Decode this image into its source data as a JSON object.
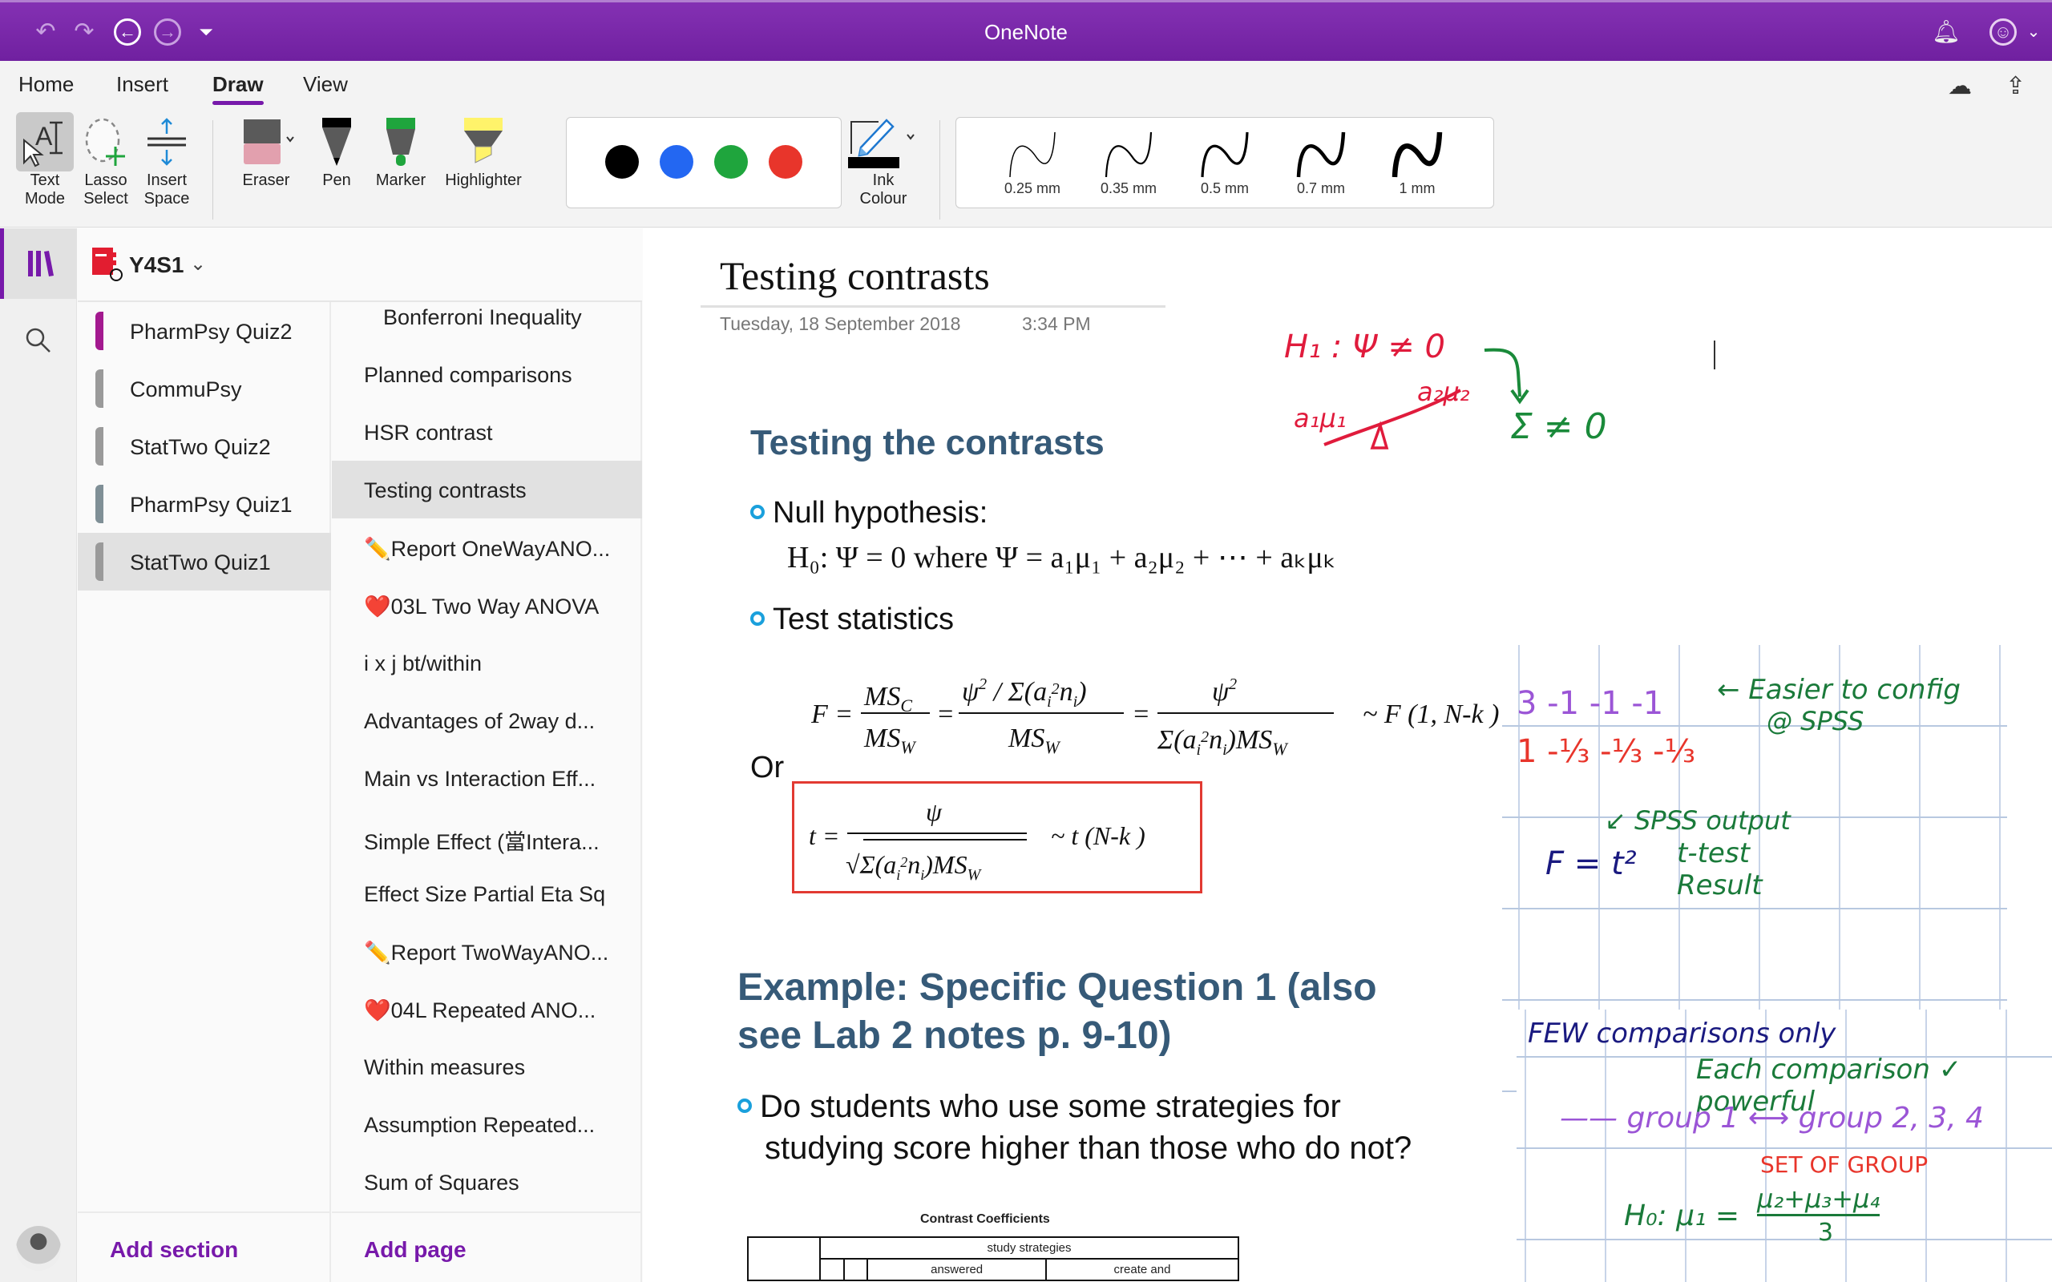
{
  "app": {
    "title": "OneNote"
  },
  "titlebar": {
    "icons": [
      "undo-icon",
      "redo-icon",
      "back-icon",
      "forward-icon",
      "customize-toolbar-icon",
      "notification-bell-icon",
      "feedback-smiley-icon"
    ]
  },
  "ribbon": {
    "tabs": [
      {
        "label": "Home",
        "active": false
      },
      {
        "label": "Insert",
        "active": false
      },
      {
        "label": "Draw",
        "active": true
      },
      {
        "label": "View",
        "active": false
      }
    ],
    "tools": {
      "text_mode": {
        "line1": "Text",
        "line2": "Mode"
      },
      "lasso_select": {
        "line1": "Lasso",
        "line2": "Select"
      },
      "insert_space": {
        "line1": "Insert",
        "line2": "Space"
      },
      "eraser": "Eraser",
      "pen": "Pen",
      "marker": "Marker",
      "highlighter": "Highlighter",
      "ink_colour": {
        "line1": "Ink",
        "line2": "Colour"
      }
    },
    "colors": [
      "#000000",
      "#2367f2",
      "#1fa53d",
      "#e8352b"
    ],
    "thicknesses": [
      "0.25 mm",
      "0.35 mm",
      "0.5 mm",
      "0.7 mm",
      "1 mm"
    ]
  },
  "notebook": {
    "name": "Y4S1"
  },
  "sections": [
    {
      "label": "PharmPsy Quiz2",
      "color": "#a3198f",
      "active": false
    },
    {
      "label": "CommuPsy",
      "color": "#9a9a9a",
      "active": false
    },
    {
      "label": "StatTwo Quiz2",
      "color": "#9a9a9a",
      "active": false
    },
    {
      "label": "PharmPsy Quiz1",
      "color": "#7f8f96",
      "active": false
    },
    {
      "label": "StatTwo Quiz1",
      "color": "#9a9a9a",
      "active": true
    }
  ],
  "pages": [
    {
      "label": "Bonferroni Inequality",
      "sub": true
    },
    {
      "label": "Planned comparisons"
    },
    {
      "label": "HSR contrast"
    },
    {
      "label": "Testing contrasts",
      "active": true
    },
    {
      "label": "✏️Report OneWayANO..."
    },
    {
      "label": "❤️03L Two Way ANOVA"
    },
    {
      "label": "i x j bt/within"
    },
    {
      "label": "Advantages of 2way d..."
    },
    {
      "label": "Main vs Interaction Eff..."
    },
    {
      "label": "Simple Effect (當Intera..."
    },
    {
      "label": "Effect Size Partial Eta Sq"
    },
    {
      "label": "✏️Report TwoWayANO..."
    },
    {
      "label": "❤️04L Repeated ANO..."
    },
    {
      "label": "Within measures"
    },
    {
      "label": "Assumption Repeated..."
    },
    {
      "label": "Sum of Squares"
    }
  ],
  "footer": {
    "add_section": "Add section",
    "add_page": "Add page"
  },
  "content": {
    "title": "Testing contrasts",
    "date": "Tuesday, 18 September 2018",
    "time": "3:34 PM",
    "slide1": {
      "heading": "Testing the contrasts",
      "bullet1": "Null hypothesis:",
      "h0_line": "H₀: Ψ = 0 where Ψ = a₁μ₁ + a₂μ₂ + ⋯ + aₖμₖ",
      "bullet2": "Test statistics",
      "f_formula": "F = MS_C / MS_W = (ψ² / Σ(aᵢ²nᵢ)) / MS_W = ψ² / (Σ(aᵢ²nᵢ) MS_W)",
      "f_dist": "~ F (1, N-k )",
      "or": "Or",
      "t_formula": "t = ψ / √(Σ(aᵢ²nᵢ) MS_W)",
      "t_dist": "~ t (N-k )"
    },
    "slide2": {
      "heading_line1": "Example: Specific Question 1 (also",
      "heading_line2": "see Lab 2 notes p. 9-10)",
      "bullet_line1": "Do students who use some strategies for",
      "bullet_line2": "studying score higher than those who do not?",
      "table_title": "Contrast Coefficients",
      "table_header": "study strategies",
      "table_cols": [
        "",
        "",
        "answered",
        "create and"
      ]
    },
    "ink": {
      "h1": "H₁ : Ψ ≠ 0",
      "a1mu1": "a₁μ₁",
      "a2mu2": "a₂μ₂",
      "sum_ne0": "Σ ≠ 0",
      "row1": "3  -1  -1  -1",
      "row2": "1  -⅓ -⅓ -⅓",
      "easier": "← Easier to config",
      "at_spss": "@ SPSS",
      "f_eq": "F = t²",
      "spss_output": "↙ SPSS output",
      "ttest": "t-test",
      "result": "Result",
      "few": "FEW comparisons only",
      "each": "Each comparison ✓ powerful",
      "groups": "——  group 1 ⟷ group 2, 3, 4",
      "set_of_group": "SET OF GROUP",
      "h0_hand": "H₀:  μ₁ =",
      "h0_num": "μ₂+μ₃+μ₄",
      "h0_den": "3"
    }
  }
}
